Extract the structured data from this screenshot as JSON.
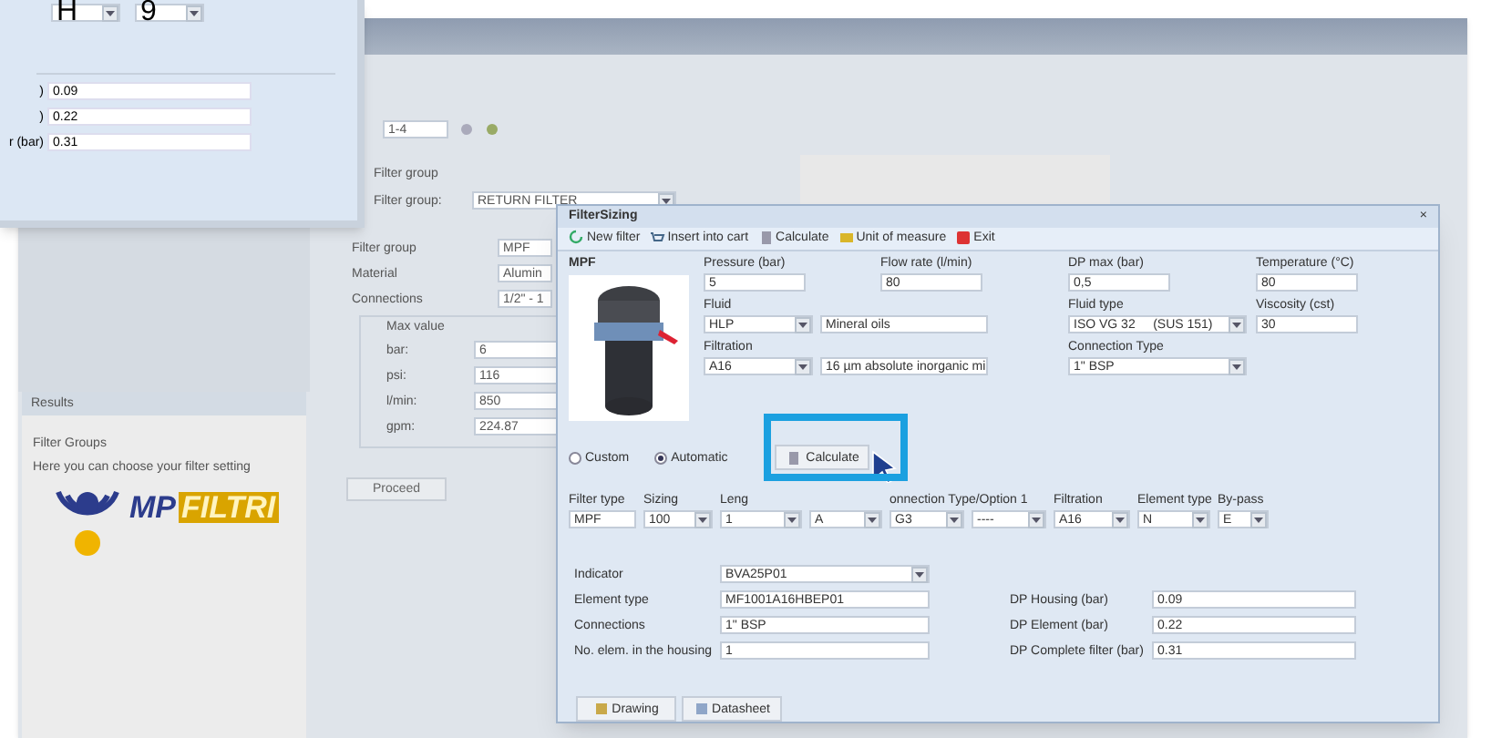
{
  "result_window": {
    "top_selects": [
      "H",
      "9"
    ],
    "rows": [
      {
        "label": ")",
        "value": "0.09"
      },
      {
        "label": ")",
        "value": "0.22"
      },
      {
        "label": "r (bar)",
        "value": "0.31"
      }
    ]
  },
  "main_window": {
    "range_value": "1-4",
    "filter_group_heading": "Filter group",
    "filter_group_label": "Filter group:",
    "filter_group_value": "RETURN FILTER",
    "properties": [
      {
        "label": "Filter group",
        "value": "MPF"
      },
      {
        "label": "Material",
        "value": "Alumin"
      },
      {
        "label": "Connections",
        "value": "1/2\" - 1"
      }
    ],
    "max_value": {
      "title": "Max value",
      "rows": [
        {
          "label": "bar:",
          "value": "6"
        },
        {
          "label": "psi:",
          "value": "116"
        },
        {
          "label": "l/min:",
          "value": "850"
        },
        {
          "label": "gpm:",
          "value": "224.87"
        }
      ]
    },
    "proceed_button": "Proceed",
    "results_panel": {
      "title": "Results",
      "heading": "Filter Groups",
      "text": "Here you can choose your filter setting",
      "logo": {
        "mark": "MP",
        "word": "FILTRI"
      }
    }
  },
  "dialog": {
    "title": "FilterSizing",
    "close": "×",
    "toolbar": [
      {
        "label": "New filter",
        "kind": "new"
      },
      {
        "label": "Insert into cart",
        "kind": "cart"
      },
      {
        "label": "Calculate",
        "kind": "calc"
      },
      {
        "label": "Unit of measure",
        "kind": "unit"
      },
      {
        "label": "Exit",
        "kind": "exit"
      }
    ],
    "product_label": "MPF",
    "pressure": {
      "label": "Pressure (bar)",
      "value": "5"
    },
    "flow_rate": {
      "label": "Flow rate (l/min)",
      "value": "80"
    },
    "dp_max": {
      "label": "DP max (bar)",
      "value": "0,5"
    },
    "temperature": {
      "label": "Temperature (°C)",
      "value": "80"
    },
    "fluid": {
      "label": "Fluid",
      "value": "HLP",
      "description": "Mineral oils"
    },
    "fluid_type": {
      "label": "Fluid type",
      "value": "ISO VG 32     (SUS 151)"
    },
    "viscosity": {
      "label": "Viscosity (cst)",
      "value": "30"
    },
    "filtration": {
      "label": "Filtration",
      "value": "A16",
      "description": "16 µm absolute inorganic mi"
    },
    "connection_type": {
      "label": "Connection Type",
      "value": "1\" BSP"
    },
    "modes": [
      {
        "label": "Custom",
        "selected": false
      },
      {
        "label": "Automatic",
        "selected": true
      }
    ],
    "calculate_button": "Calculate",
    "code_columns": [
      {
        "header": "Filter type",
        "value": "MPF",
        "kind": "text"
      },
      {
        "header": "Sizing",
        "value": "100",
        "kind": "select"
      },
      {
        "header": "Leng",
        "value": "1",
        "kind": "select"
      },
      {
        "value": "A",
        "kind": "select"
      },
      {
        "header": "onnection Type/Option 1",
        "value": "G3",
        "kind": "select"
      },
      {
        "value": "----",
        "kind": "select"
      },
      {
        "header": "Filtration",
        "value": "A16",
        "kind": "select"
      },
      {
        "header": "Element type",
        "value": "N",
        "kind": "select"
      },
      {
        "header": "By-pass",
        "value": "E",
        "kind": "select"
      }
    ],
    "details_left": [
      {
        "label": "Indicator",
        "value": "BVA25P01",
        "kind": "select"
      },
      {
        "label": "Element type",
        "value": "MF1001A16HBEP01",
        "kind": "text"
      },
      {
        "label": "Connections",
        "value": "1\" BSP",
        "kind": "text"
      },
      {
        "label": "No. elem. in the housing",
        "value": "1",
        "kind": "text"
      }
    ],
    "details_right": [
      {
        "label": "DP Housing (bar)",
        "value": "0.09"
      },
      {
        "label": "DP Element (bar)",
        "value": "0.22"
      },
      {
        "label": "DP Complete filter (bar)",
        "value": "0.31"
      }
    ],
    "buttons": [
      {
        "label": "Drawing",
        "kind": "drawing"
      },
      {
        "label": "Datasheet",
        "kind": "datasheet"
      }
    ]
  }
}
